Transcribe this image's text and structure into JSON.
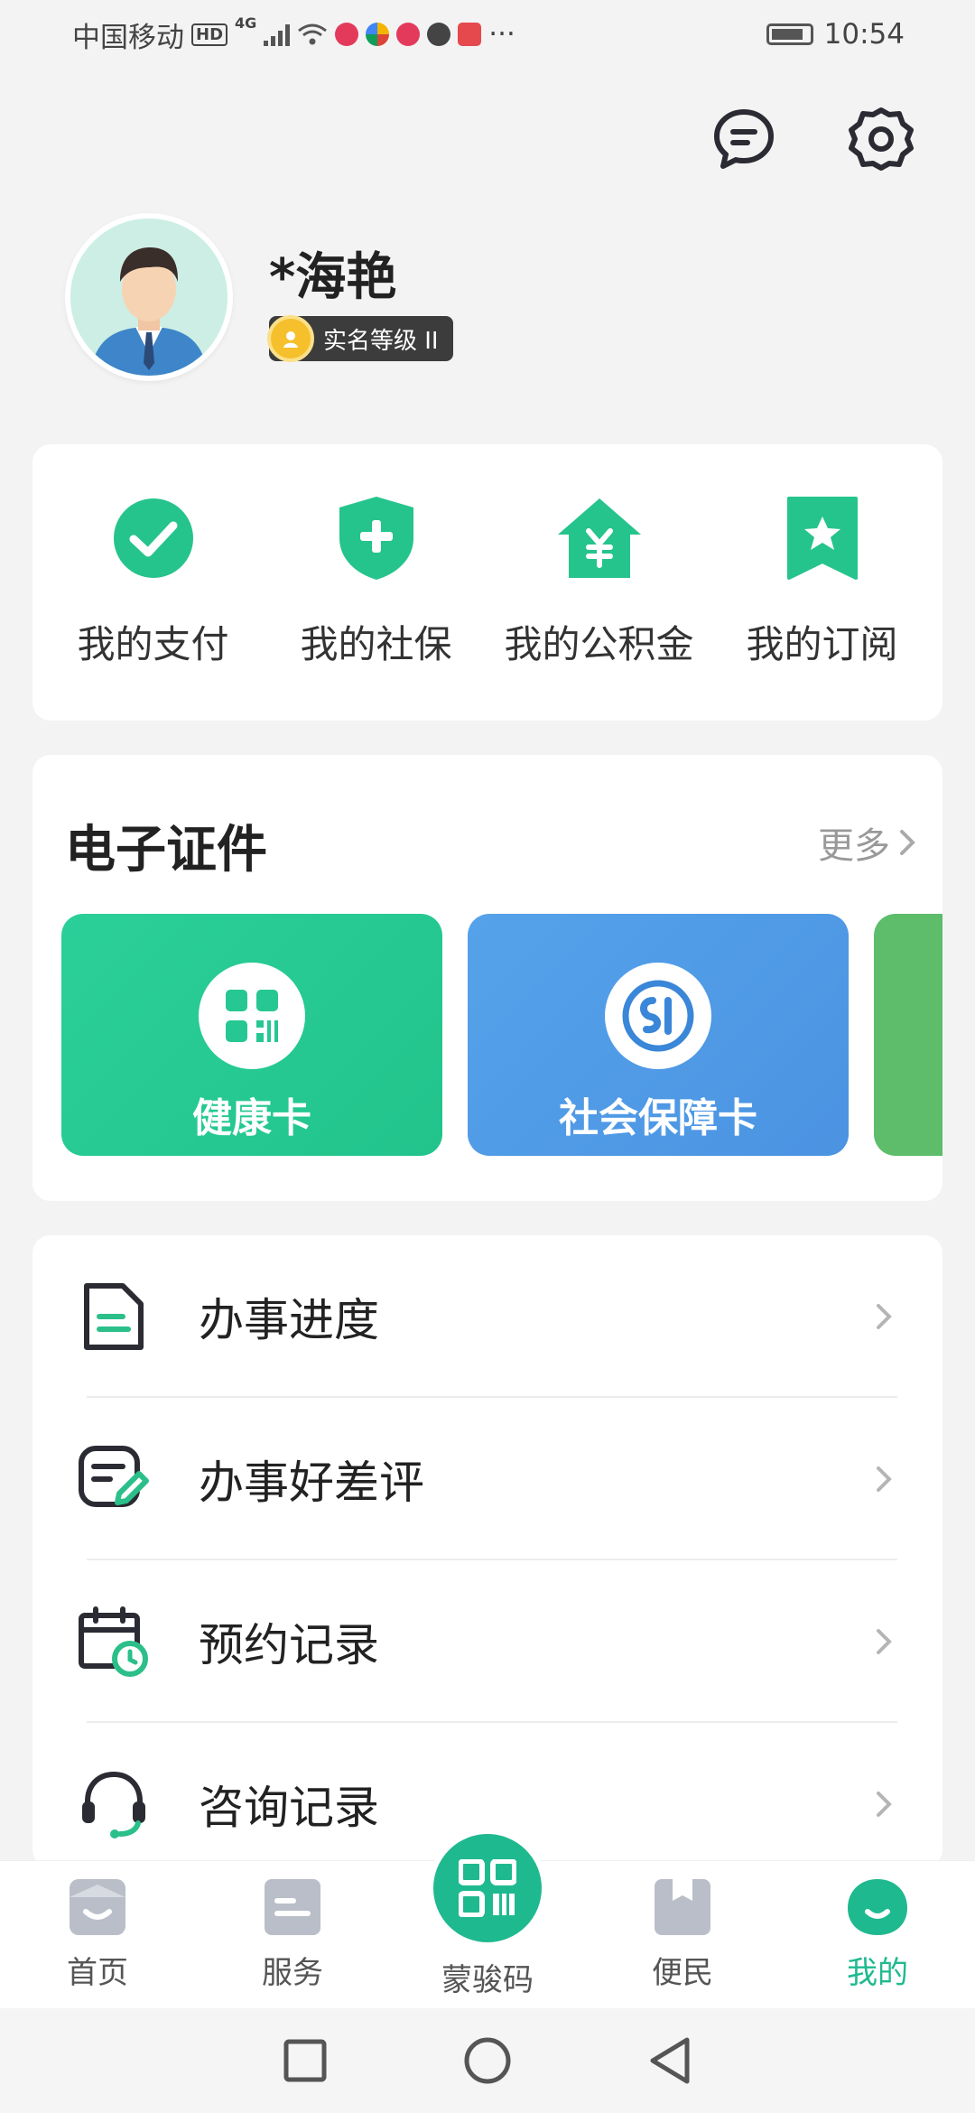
{
  "status_bar": {
    "carrier": "中国移动",
    "network_badge": "HD",
    "network_type": "4G",
    "time": "10:54",
    "more": "···"
  },
  "header": {
    "message_icon": "message-icon",
    "settings_icon": "gear-icon"
  },
  "profile": {
    "name": "*海艳",
    "verify_level": "实名等级 II"
  },
  "quick_actions": [
    {
      "label": "我的支付",
      "icon": "check-circle-icon"
    },
    {
      "label": "我的社保",
      "icon": "shield-plus-icon"
    },
    {
      "label": "我的公积金",
      "icon": "house-yuan-icon"
    },
    {
      "label": "我的订阅",
      "icon": "bookmark-star-icon"
    }
  ],
  "certificates": {
    "title": "电子证件",
    "more": "更多",
    "items": [
      {
        "label": "健康卡",
        "icon": "qr-code-icon",
        "color": "#26c792"
      },
      {
        "label": "社会保障卡",
        "icon": "social-security-icon",
        "color": "#4f98e6"
      }
    ]
  },
  "menu": [
    {
      "label": "办事进度",
      "icon": "document-icon"
    },
    {
      "label": "办事好差评",
      "icon": "review-edit-icon"
    },
    {
      "label": "预约记录",
      "icon": "calendar-clock-icon"
    },
    {
      "label": "咨询记录",
      "icon": "headset-icon"
    }
  ],
  "bottom_nav": [
    {
      "label": "首页",
      "icon": "home-icon",
      "active": false
    },
    {
      "label": "服务",
      "icon": "service-icon",
      "active": false
    },
    {
      "label": "蒙骏码",
      "icon": "qr-code-icon",
      "active": false
    },
    {
      "label": "便民",
      "icon": "bookmark-icon",
      "active": false
    },
    {
      "label": "我的",
      "icon": "profile-icon",
      "active": true
    }
  ],
  "colors": {
    "accent": "#1fb98f",
    "text": "#222222",
    "muted": "#999999",
    "background": "#f3f3f3"
  }
}
